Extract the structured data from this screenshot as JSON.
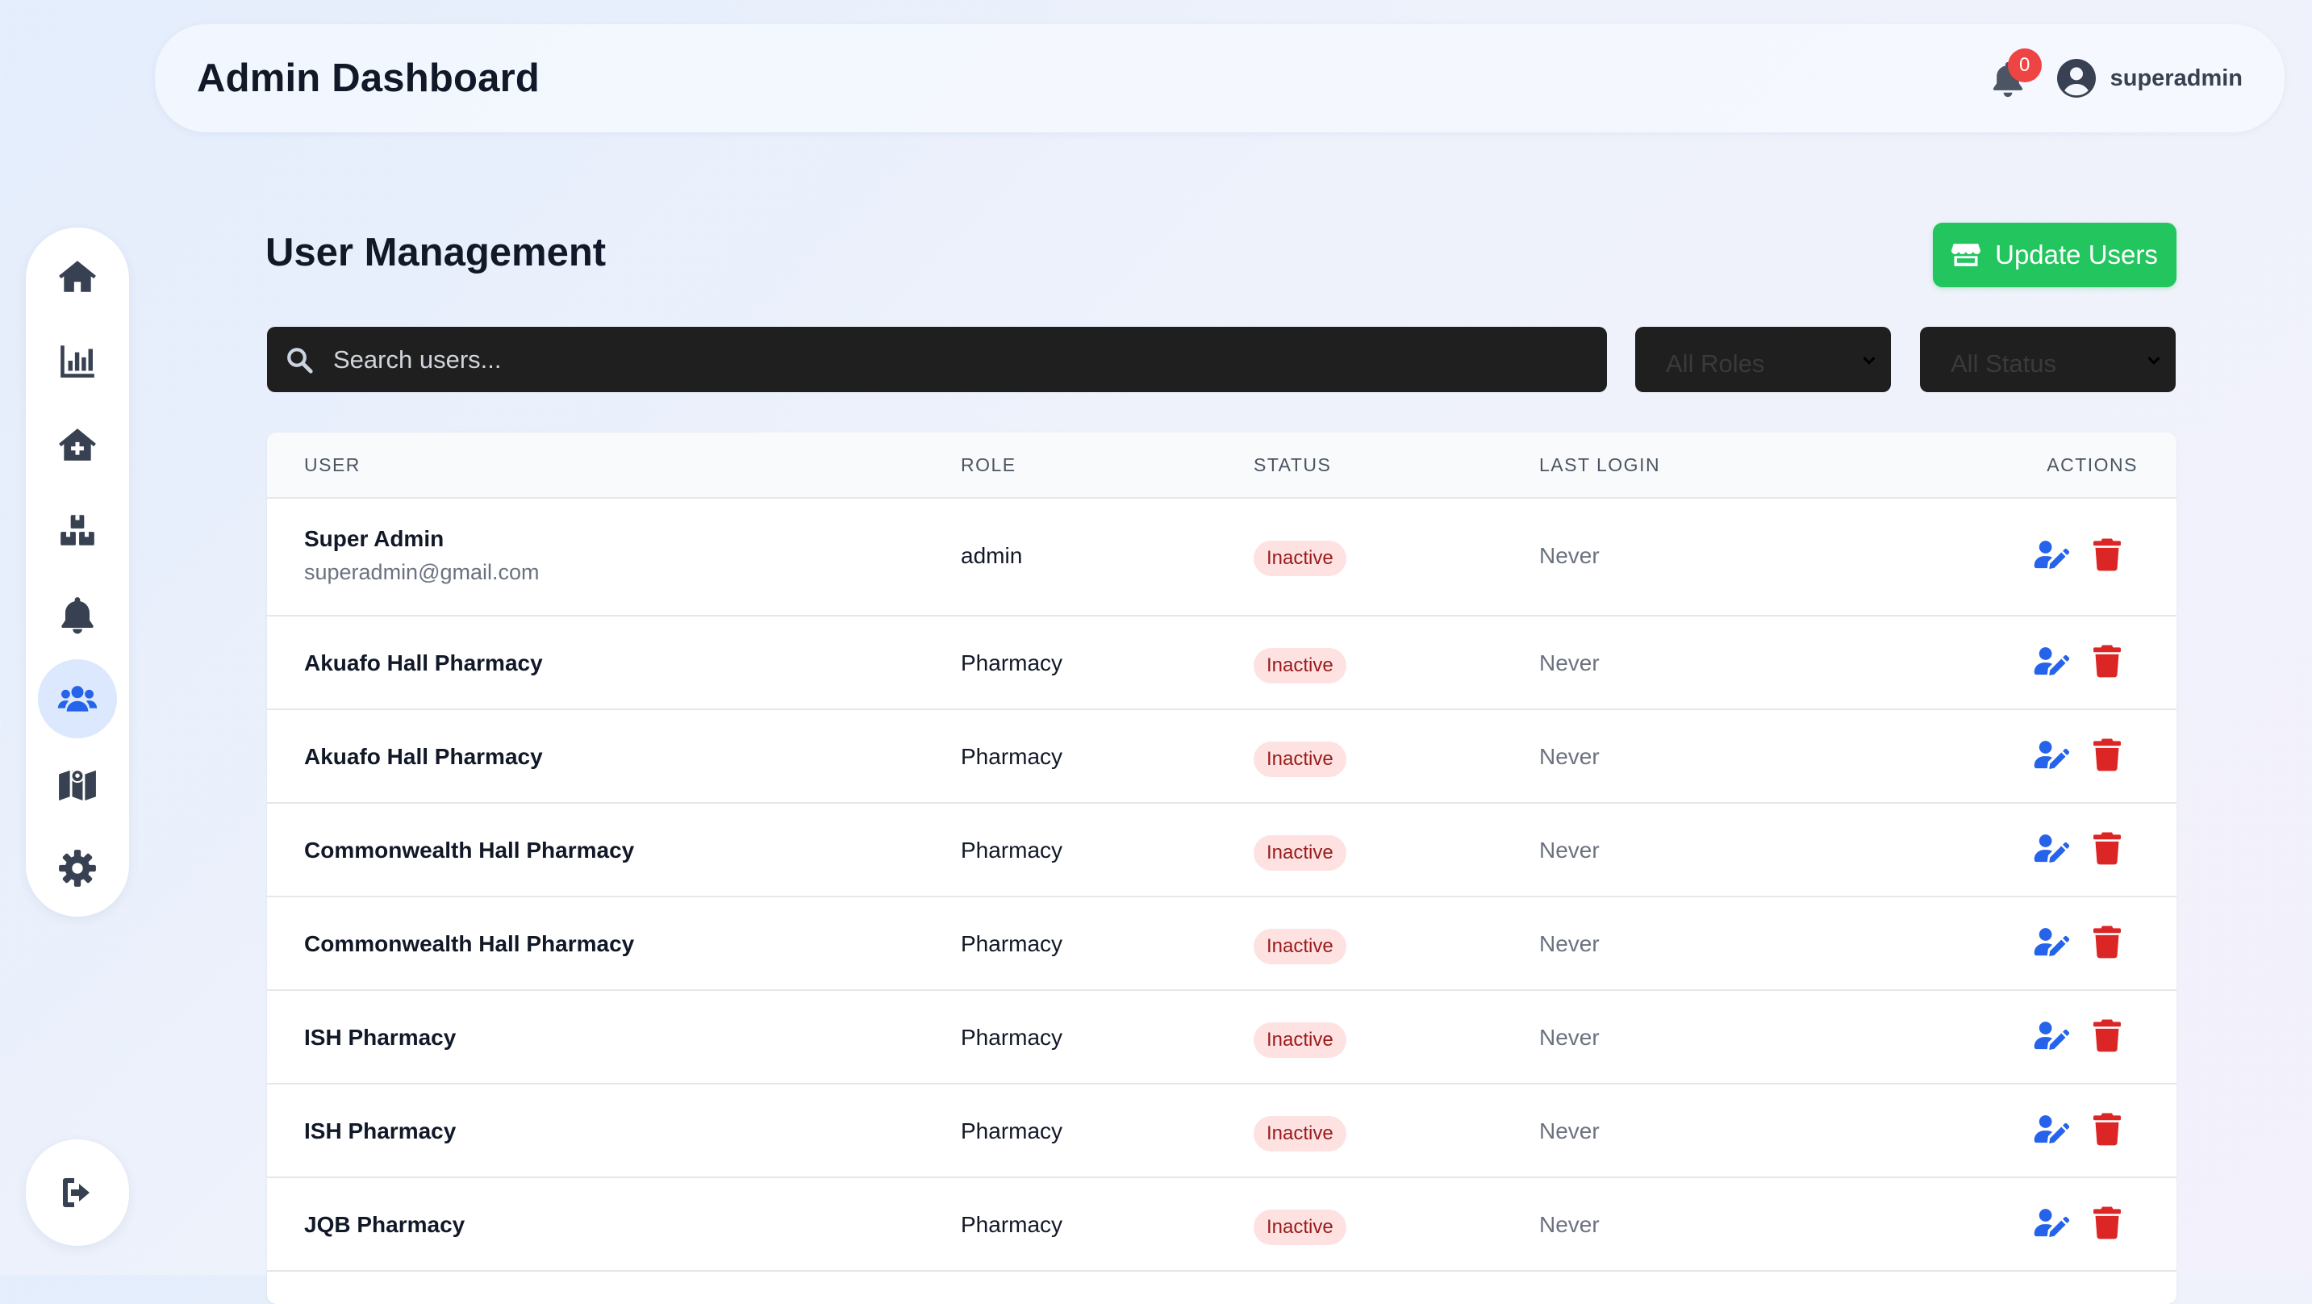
{
  "header": {
    "title": "Admin Dashboard",
    "notification_count": "0",
    "username": "superadmin"
  },
  "sidebar": {
    "items": [
      {
        "icon": "home-icon",
        "active": false
      },
      {
        "icon": "chart-bar-icon",
        "active": false
      },
      {
        "icon": "clinic-house-icon",
        "active": false
      },
      {
        "icon": "boxes-icon",
        "active": false
      },
      {
        "icon": "bell-icon",
        "active": false
      },
      {
        "icon": "users-icon",
        "active": true
      },
      {
        "icon": "map-icon",
        "active": false
      },
      {
        "icon": "gear-icon",
        "active": false
      }
    ],
    "logout_icon": "sign-out-icon"
  },
  "main": {
    "title": "User Management",
    "update_button_label": "Update Users",
    "search_placeholder": "Search users...",
    "role_filter": "All Roles",
    "status_filter": "All Status"
  },
  "table": {
    "headers": {
      "user": "USER",
      "role": "ROLE",
      "status": "STATUS",
      "last_login": "LAST LOGIN",
      "actions": "ACTIONS"
    },
    "rows": [
      {
        "name": "Super Admin",
        "email": "superadmin@gmail.com",
        "role": "admin",
        "status": "Inactive",
        "last_login": "Never"
      },
      {
        "name": "Akuafo Hall Pharmacy",
        "email": "",
        "role": "Pharmacy",
        "status": "Inactive",
        "last_login": "Never"
      },
      {
        "name": "Akuafo Hall Pharmacy",
        "email": "",
        "role": "Pharmacy",
        "status": "Inactive",
        "last_login": "Never"
      },
      {
        "name": "Commonwealth Hall Pharmacy",
        "email": "",
        "role": "Pharmacy",
        "status": "Inactive",
        "last_login": "Never"
      },
      {
        "name": "Commonwealth Hall Pharmacy",
        "email": "",
        "role": "Pharmacy",
        "status": "Inactive",
        "last_login": "Never"
      },
      {
        "name": "ISH Pharmacy",
        "email": "",
        "role": "Pharmacy",
        "status": "Inactive",
        "last_login": "Never"
      },
      {
        "name": "ISH Pharmacy",
        "email": "",
        "role": "Pharmacy",
        "status": "Inactive",
        "last_login": "Never"
      },
      {
        "name": "JQB Pharmacy",
        "email": "",
        "role": "Pharmacy",
        "status": "Inactive",
        "last_login": "Never"
      }
    ]
  },
  "colors": {
    "accent_green": "#22c55e",
    "edit_blue": "#2563eb",
    "delete_red": "#dc2626",
    "badge_red": "#ef4444",
    "inactive_bg": "#fee2e2",
    "inactive_text": "#991b1b",
    "active_nav_bg": "#dbe8fd",
    "icon_slate": "#374151"
  }
}
